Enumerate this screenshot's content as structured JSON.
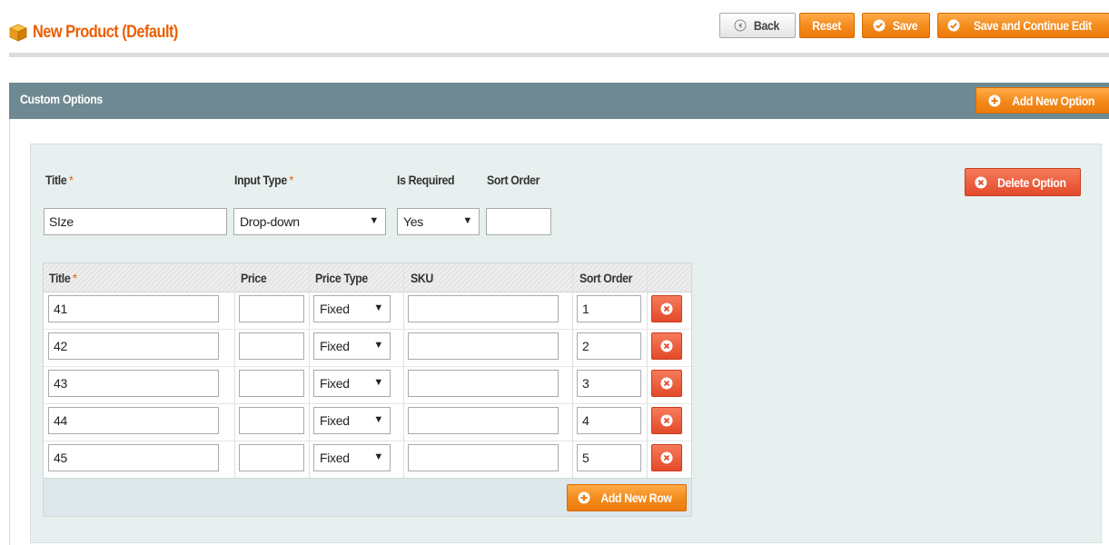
{
  "header": {
    "title": "New Product (Default)",
    "buttons": {
      "back": "Back",
      "reset": "Reset",
      "save": "Save",
      "save_continue": "Save and Continue Edit"
    }
  },
  "section": {
    "title": "Custom Options",
    "add_option": "Add New Option"
  },
  "option": {
    "labels": {
      "title": "Title",
      "input_type": "Input Type",
      "is_required": "Is Required",
      "sort_order": "Sort Order",
      "required_mark": "*"
    },
    "title_value": "SIze",
    "input_type_value": "Drop-down",
    "is_required_value": "Yes",
    "sort_order_value": "",
    "delete_label": "Delete Option"
  },
  "values_table": {
    "headers": {
      "title": "Title",
      "price": "Price",
      "price_type": "Price Type",
      "sku": "SKU",
      "sort_order": "Sort Order"
    },
    "rows": [
      {
        "title": "41",
        "price": "",
        "price_type": "Fixed",
        "sku": "",
        "sort_order": "1"
      },
      {
        "title": "42",
        "price": "",
        "price_type": "Fixed",
        "sku": "",
        "sort_order": "2"
      },
      {
        "title": "43",
        "price": "",
        "price_type": "Fixed",
        "sku": "",
        "sort_order": "3"
      },
      {
        "title": "44",
        "price": "",
        "price_type": "Fixed",
        "sku": "",
        "sort_order": "4"
      },
      {
        "title": "45",
        "price": "",
        "price_type": "Fixed",
        "sku": "",
        "sort_order": "5"
      }
    ],
    "add_row": "Add New Row"
  },
  "colors": {
    "accent_orange": "#eb5e00",
    "button_orange": "#f28a1a",
    "section_header": "#6f8992",
    "option_bg": "#e7efef",
    "delete_red": "#e34a2a"
  },
  "icons": {
    "title": "product-box-icon",
    "back": "back-arrow-icon",
    "save": "check-circle-icon",
    "add": "plus-circle-icon",
    "delete": "x-circle-icon"
  }
}
